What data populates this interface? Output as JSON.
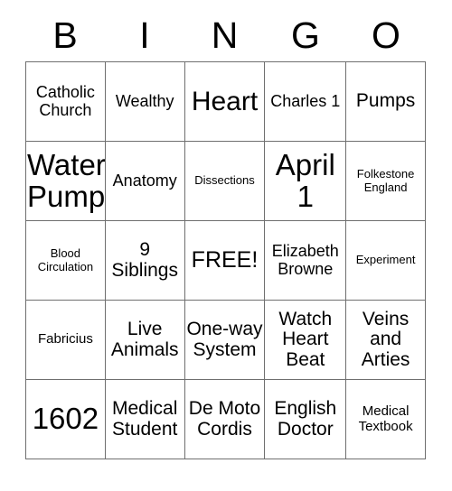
{
  "card": {
    "header_letters": [
      "B",
      "I",
      "N",
      "G",
      "O"
    ],
    "columns": 5,
    "rows": 5,
    "border_color": "#6f6f6f",
    "cell_background": "#ffffff",
    "text_color": "#000000",
    "free_space_label": "FREE!",
    "cells": [
      [
        {
          "text": "Catholic Church",
          "size": "md"
        },
        {
          "text": "Wealthy",
          "size": "md"
        },
        {
          "text": "Heart",
          "size": "xxl"
        },
        {
          "text": "Charles 1",
          "size": "md"
        },
        {
          "text": "Pumps",
          "size": "lg"
        }
      ],
      [
        {
          "text": "Water Pump",
          "size": "max"
        },
        {
          "text": "Anatomy",
          "size": "md"
        },
        {
          "text": "Dissections",
          "size": "xs"
        },
        {
          "text": "April 1",
          "size": "max"
        },
        {
          "text": "Folkestone England",
          "size": "xs"
        }
      ],
      [
        {
          "text": "Blood Circulation",
          "size": "xs"
        },
        {
          "text": "9 Siblings",
          "size": "lg"
        },
        {
          "text": "FREE!",
          "size": "xl"
        },
        {
          "text": "Elizabeth Browne",
          "size": "md"
        },
        {
          "text": "Experiment",
          "size": "xs"
        }
      ],
      [
        {
          "text": "Fabricius",
          "size": "sm"
        },
        {
          "text": "Live Animals",
          "size": "lg"
        },
        {
          "text": "One-way System",
          "size": "lg"
        },
        {
          "text": "Watch Heart Beat",
          "size": "lg"
        },
        {
          "text": "Veins and Arties",
          "size": "lg"
        }
      ],
      [
        {
          "text": "1602",
          "size": "max"
        },
        {
          "text": "Medical Student",
          "size": "lg"
        },
        {
          "text": "De Moto Cordis",
          "size": "lg"
        },
        {
          "text": "English Doctor",
          "size": "lg"
        },
        {
          "text": "Medical Textbook",
          "size": "sm"
        }
      ]
    ]
  }
}
